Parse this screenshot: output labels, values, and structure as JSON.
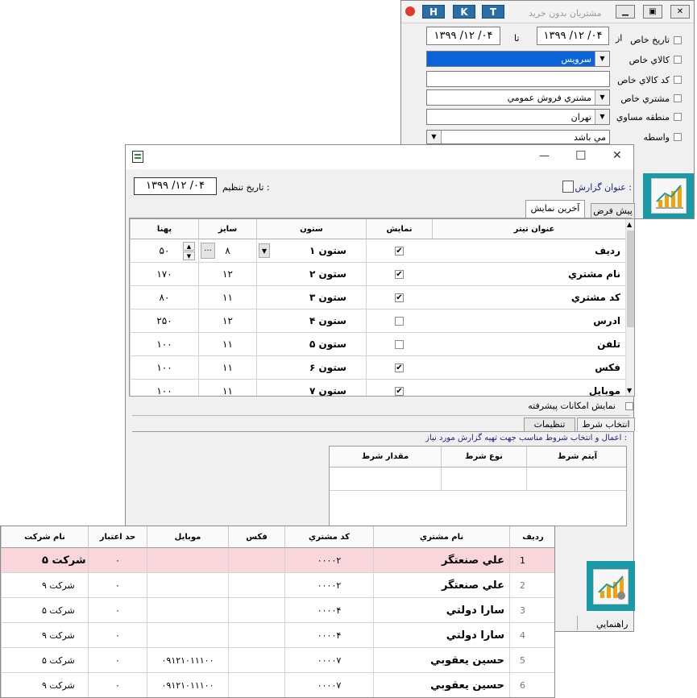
{
  "back_window": {
    "title": "مشتريان بدون خريد",
    "buttons": [
      "H",
      "K",
      "T"
    ],
    "controls": [
      "▁",
      "▣",
      "✕"
    ],
    "filters": [
      {
        "label": "تاريخ خاص",
        "checked": false
      },
      {
        "label": "كالاي خاص",
        "checked": false
      },
      {
        "label": "كد كالاي خاص",
        "checked": false
      },
      {
        "label": "مشتري خاص",
        "checked": false
      },
      {
        "label": "منطقه مساوي",
        "checked": false
      },
      {
        "label": "واسطه",
        "checked": false
      }
    ],
    "from_label": "از",
    "to_label": "تا",
    "date_from": "۱۳۹۹ /۱۲ /۰۴",
    "date_to": "۱۳۹۹ /۱۲ /۰۴",
    "product_value": "سرويس",
    "product_code_value": "",
    "customer_value": "مشتري فروش عمومي",
    "region_value": "تهران",
    "agent_value": "مي باشد",
    "dropdown_arrow": "▼"
  },
  "mid_window": {
    "controls": [
      "—",
      "☐",
      "✕"
    ],
    "report_title_label": "عنوان گزارش :",
    "setup_date_label": "تاريخ تنظيم :",
    "setup_date_value": "۱۳۹۹ /۱۲ /۰۴",
    "tabs": [
      "پيش فرض",
      "آخرين نمايش"
    ],
    "columns_headers": [
      "عنوان تيتر",
      "نمايش",
      "ستون",
      "سايز",
      "پهنا"
    ],
    "columns_rows": [
      {
        "title": "رديف",
        "show": true,
        "col": "ستون ۱",
        "size": "۸",
        "width": "۵۰"
      },
      {
        "title": "نام مشتري",
        "show": true,
        "col": "ستون ۲",
        "size": "۱۲",
        "width": "۱۷۰"
      },
      {
        "title": "كد مشتري",
        "show": true,
        "col": "ستون ۳",
        "size": "۱۱",
        "width": "۸۰"
      },
      {
        "title": "ادرس",
        "show": false,
        "col": "ستون ۴",
        "size": "۱۲",
        "width": "۲۵۰"
      },
      {
        "title": "تلفن",
        "show": false,
        "col": "ستون ۵",
        "size": "۱۱",
        "width": "۱۰۰"
      },
      {
        "title": "فكس",
        "show": true,
        "col": "ستون ۶",
        "size": "۱۱",
        "width": "۱۰۰"
      },
      {
        "title": "موبايل",
        "show": true,
        "col": "ستون ۷",
        "size": "۱۱",
        "width": "۱۰۰"
      }
    ],
    "advanced_label": "نمايش امكانات پيشرفته",
    "bottom_tabs": [
      "انتخاب شرط",
      "تنظيمات"
    ],
    "condition_hint": "اعمال و انتخاب شروط مناسب جهت تهيه گزارش  مورد نياز :",
    "condition_headers": [
      "آيتم شرط",
      "نوع شرط",
      "مقدار شرط"
    ],
    "help_label": "راهنمايي",
    "ellipsis": "...",
    "up_arrow": "▲",
    "down_arrow": "▼"
  },
  "result_grid": {
    "headers": [
      "رديف",
      "نام مشتري",
      "كد مشتري",
      "فكس",
      "موبايل",
      "حد اعتبار",
      "نام شركت"
    ],
    "rows": [
      {
        "row": "1",
        "name": "علي صنعتگر",
        "code": "۰۰۰۰۲",
        "fax": "",
        "mobile": "",
        "credit": "۰",
        "company": "شركت ۵",
        "highlight": true
      },
      {
        "row": "2",
        "name": "علي صنعتگر",
        "code": "۰۰۰۰۲",
        "fax": "",
        "mobile": "",
        "credit": "۰",
        "company": "شركت ۹",
        "highlight": false
      },
      {
        "row": "3",
        "name": "سارا دولتي",
        "code": "۰۰۰۰۴",
        "fax": "",
        "mobile": "",
        "credit": "۰",
        "company": "شركت ۵",
        "highlight": false
      },
      {
        "row": "4",
        "name": "سارا دولتي",
        "code": "۰۰۰۰۴",
        "fax": "",
        "mobile": "",
        "credit": "۰",
        "company": "شركت ۹",
        "highlight": false
      },
      {
        "row": "5",
        "name": "حسين يعقوبي",
        "code": "۰۰۰۰۷",
        "fax": "",
        "mobile": "۰۹۱۲۱۰۱۱۱۰۰",
        "credit": "۰",
        "company": "شركت ۵",
        "highlight": false
      },
      {
        "row": "6",
        "name": "حسين يعقوبي",
        "code": "۰۰۰۰۷",
        "fax": "",
        "mobile": "۰۹۱۲۱۰۱۱۱۰۰",
        "credit": "۰",
        "company": "شركت ۹",
        "highlight": false
      }
    ]
  },
  "colors": {
    "accent_blue": "#0a64d8",
    "teal": "#1b9aa5",
    "highlight_row": "#f9d6dc",
    "title_blue": "#2a6ea6"
  }
}
